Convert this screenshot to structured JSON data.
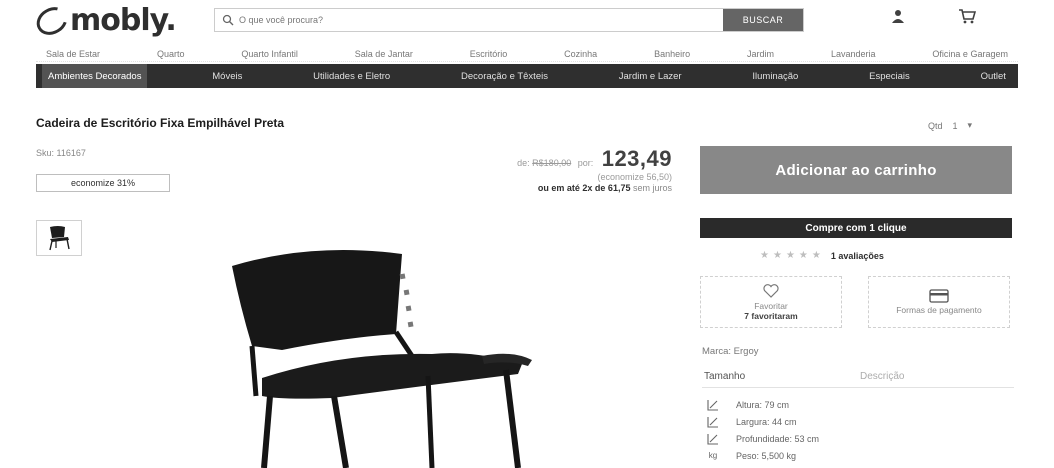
{
  "header": {
    "logo": "mobly.",
    "search_placeholder": "O que você procura?",
    "search_button": "BUSCAR"
  },
  "categories": [
    "Sala de Estar",
    "Quarto",
    "Quarto Infantil",
    "Sala de Jantar",
    "Escritório",
    "Cozinha",
    "Banheiro",
    "Jardim",
    "Lavanderia",
    "Oficina e Garagem"
  ],
  "nav": [
    "Ambientes Decorados",
    "Móveis",
    "Utilidades e Eletro",
    "Decoração e Têxteis",
    "Jardim e Lazer",
    "Iluminação",
    "Especiais",
    "Outlet"
  ],
  "product": {
    "title": "Cadeira de Escritório Fixa Empilhável Preta",
    "sku": "Sku: 116167",
    "discount_badge": "economize 31%",
    "old_price_prefix": "de:",
    "old_price": "R$180,00",
    "new_price_prefix": "por:",
    "new_price": "123,49",
    "saving": "(economize 56,50)",
    "install_prefix": "ou em até",
    "install_value": "2x de 61,75",
    "install_suffix": "sem juros",
    "qty_label": "Qtd",
    "qty_value": "1",
    "add_to_cart": "Adicionar ao carrinho",
    "one_click": "Compre com 1 clique",
    "rating_count": "1 avaliações",
    "rating_stars": 0,
    "favorites_label": "Favoritar",
    "favorites_count": "7 favoritaram",
    "payment_label": "Formas de pagamento",
    "brand": "Marca: Ergoy",
    "tab_size": "Tamanho",
    "tab_description": "Descrição",
    "specs": [
      {
        "icon": "height-icon",
        "text": "Altura: 79 cm"
      },
      {
        "icon": "width-icon",
        "text": "Largura: 44 cm"
      },
      {
        "icon": "depth-icon",
        "text": "Profundidade: 53 cm"
      },
      {
        "icon": "weight-icon",
        "text": "Peso: 5,500 kg"
      }
    ]
  }
}
